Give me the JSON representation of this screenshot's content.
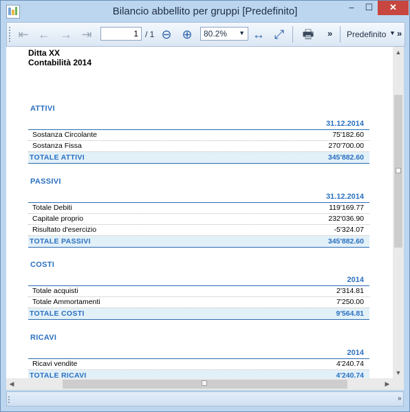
{
  "window": {
    "title": "Bilancio abbellito per gruppi [Predefinito]",
    "minimize": "–",
    "maximize": "☐",
    "close": "✕"
  },
  "toolbar": {
    "first": "⇤",
    "prev": "←",
    "next": "→",
    "last": "⇥",
    "page_value": "1",
    "page_total": "/ 1",
    "zoom_out": "⊖",
    "zoom_in": "⊕",
    "zoom_value": "80.2%",
    "fit_width": "↔",
    "fit_page": "⤢",
    "print": "🖶",
    "overflow": "»",
    "profile": "Predefinito",
    "profile_caret": "▼",
    "overflow2": "»"
  },
  "report": {
    "company": "Ditta XX",
    "subtitle": "Contabilità 2014",
    "sections": [
      {
        "title": "ATTIVI",
        "column": "31.12.2014",
        "rows": [
          {
            "label": "Sostanza Circolante",
            "value": "75'182.60"
          },
          {
            "label": "Sostanza Fissa",
            "value": "270'700.00"
          }
        ],
        "total": {
          "label": "TOTALE ATTIVI",
          "value": "345'882.60"
        }
      },
      {
        "title": "PASSIVI",
        "column": "31.12.2014",
        "rows": [
          {
            "label": "Totale Debiti",
            "value": "119'169.77"
          },
          {
            "label": "Capitale proprio",
            "value": "232'036.90"
          },
          {
            "label": "Risultato d'esercizio",
            "value": "-5'324.07"
          }
        ],
        "total": {
          "label": "TOTALE PASSIVI",
          "value": "345'882.60"
        }
      },
      {
        "title": "COSTI",
        "column": "2014",
        "rows": [
          {
            "label": "Totale acquisti",
            "value": "2'314.81"
          },
          {
            "label": "Totale Ammortamenti",
            "value": "7'250.00"
          }
        ],
        "total": {
          "label": "TOTALE COSTI",
          "value": "9'564.81"
        }
      },
      {
        "title": "RICAVI",
        "column": "2014",
        "rows": [
          {
            "label": "Ricavi vendite",
            "value": "4'240.74"
          }
        ],
        "total": {
          "label": "TOTALE RICAVI",
          "value": "4'240.74"
        }
      }
    ]
  },
  "scroll": {
    "up": "▲",
    "down": "▼",
    "left": "◀",
    "right": "▶"
  },
  "status": {
    "overflow": "»"
  }
}
